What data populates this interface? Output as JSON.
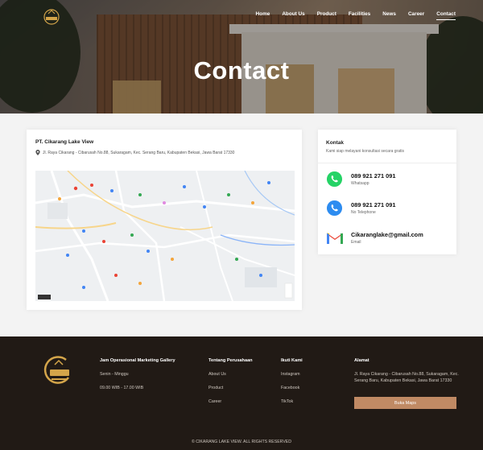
{
  "nav": {
    "items": [
      {
        "label": "Home",
        "active": false
      },
      {
        "label": "About Us",
        "active": false
      },
      {
        "label": "Product",
        "active": false
      },
      {
        "label": "Facilities",
        "active": false
      },
      {
        "label": "News",
        "active": false
      },
      {
        "label": "Career",
        "active": false
      },
      {
        "label": "Contact",
        "active": true
      }
    ]
  },
  "hero": {
    "title": "Contact"
  },
  "location": {
    "company": "PT. Cikarang Lake View",
    "address": "Jl. Raya Cikarang - Cibarusah No.88, Sukaragam, Kec. Serang Baru, Kabupaten Bekasi, Jawa Barat 17330"
  },
  "kontak": {
    "title": "Kontak",
    "subtitle": "Kami siap melayani konsultasi secara gratis",
    "items": [
      {
        "value": "089 921 271 091",
        "label": "Whatsapp",
        "icon": "whatsapp-icon",
        "color": "#25D366"
      },
      {
        "value": "089 921 271 091",
        "label": "No Telephone",
        "icon": "phone-icon",
        "color": "#2d8cf0"
      },
      {
        "value": "Cikaranglake@gmail.com",
        "label": "Email",
        "icon": "gmail-icon",
        "color": "#ea4335"
      }
    ]
  },
  "footer": {
    "hours": {
      "heading": "Jam Operasional Marketing Gallery",
      "days": "Senin - Minggu",
      "time": "09.00 WIB - 17.00 WIB"
    },
    "company": {
      "heading": "Tentang Perusahaan",
      "links": [
        "About Us",
        "Product",
        "Career"
      ]
    },
    "social": {
      "heading": "Ikuti Kami",
      "links": [
        "Instagram",
        "Facebook",
        "TikTok"
      ]
    },
    "address": {
      "heading": "Alamat",
      "text": "Jl. Raya Cikarang - Cibarusah No.88, Sukaragam, Kec. Serang Baru, Kabupaten Bekasi, Jawa Barat 17330",
      "button": "Buka Maps"
    },
    "copyright": "© CIKARANG LAKE VIEW. ALL RIGHTS RESERVED"
  },
  "colors": {
    "accent": "#c08a64",
    "footer_bg": "#211a15"
  }
}
